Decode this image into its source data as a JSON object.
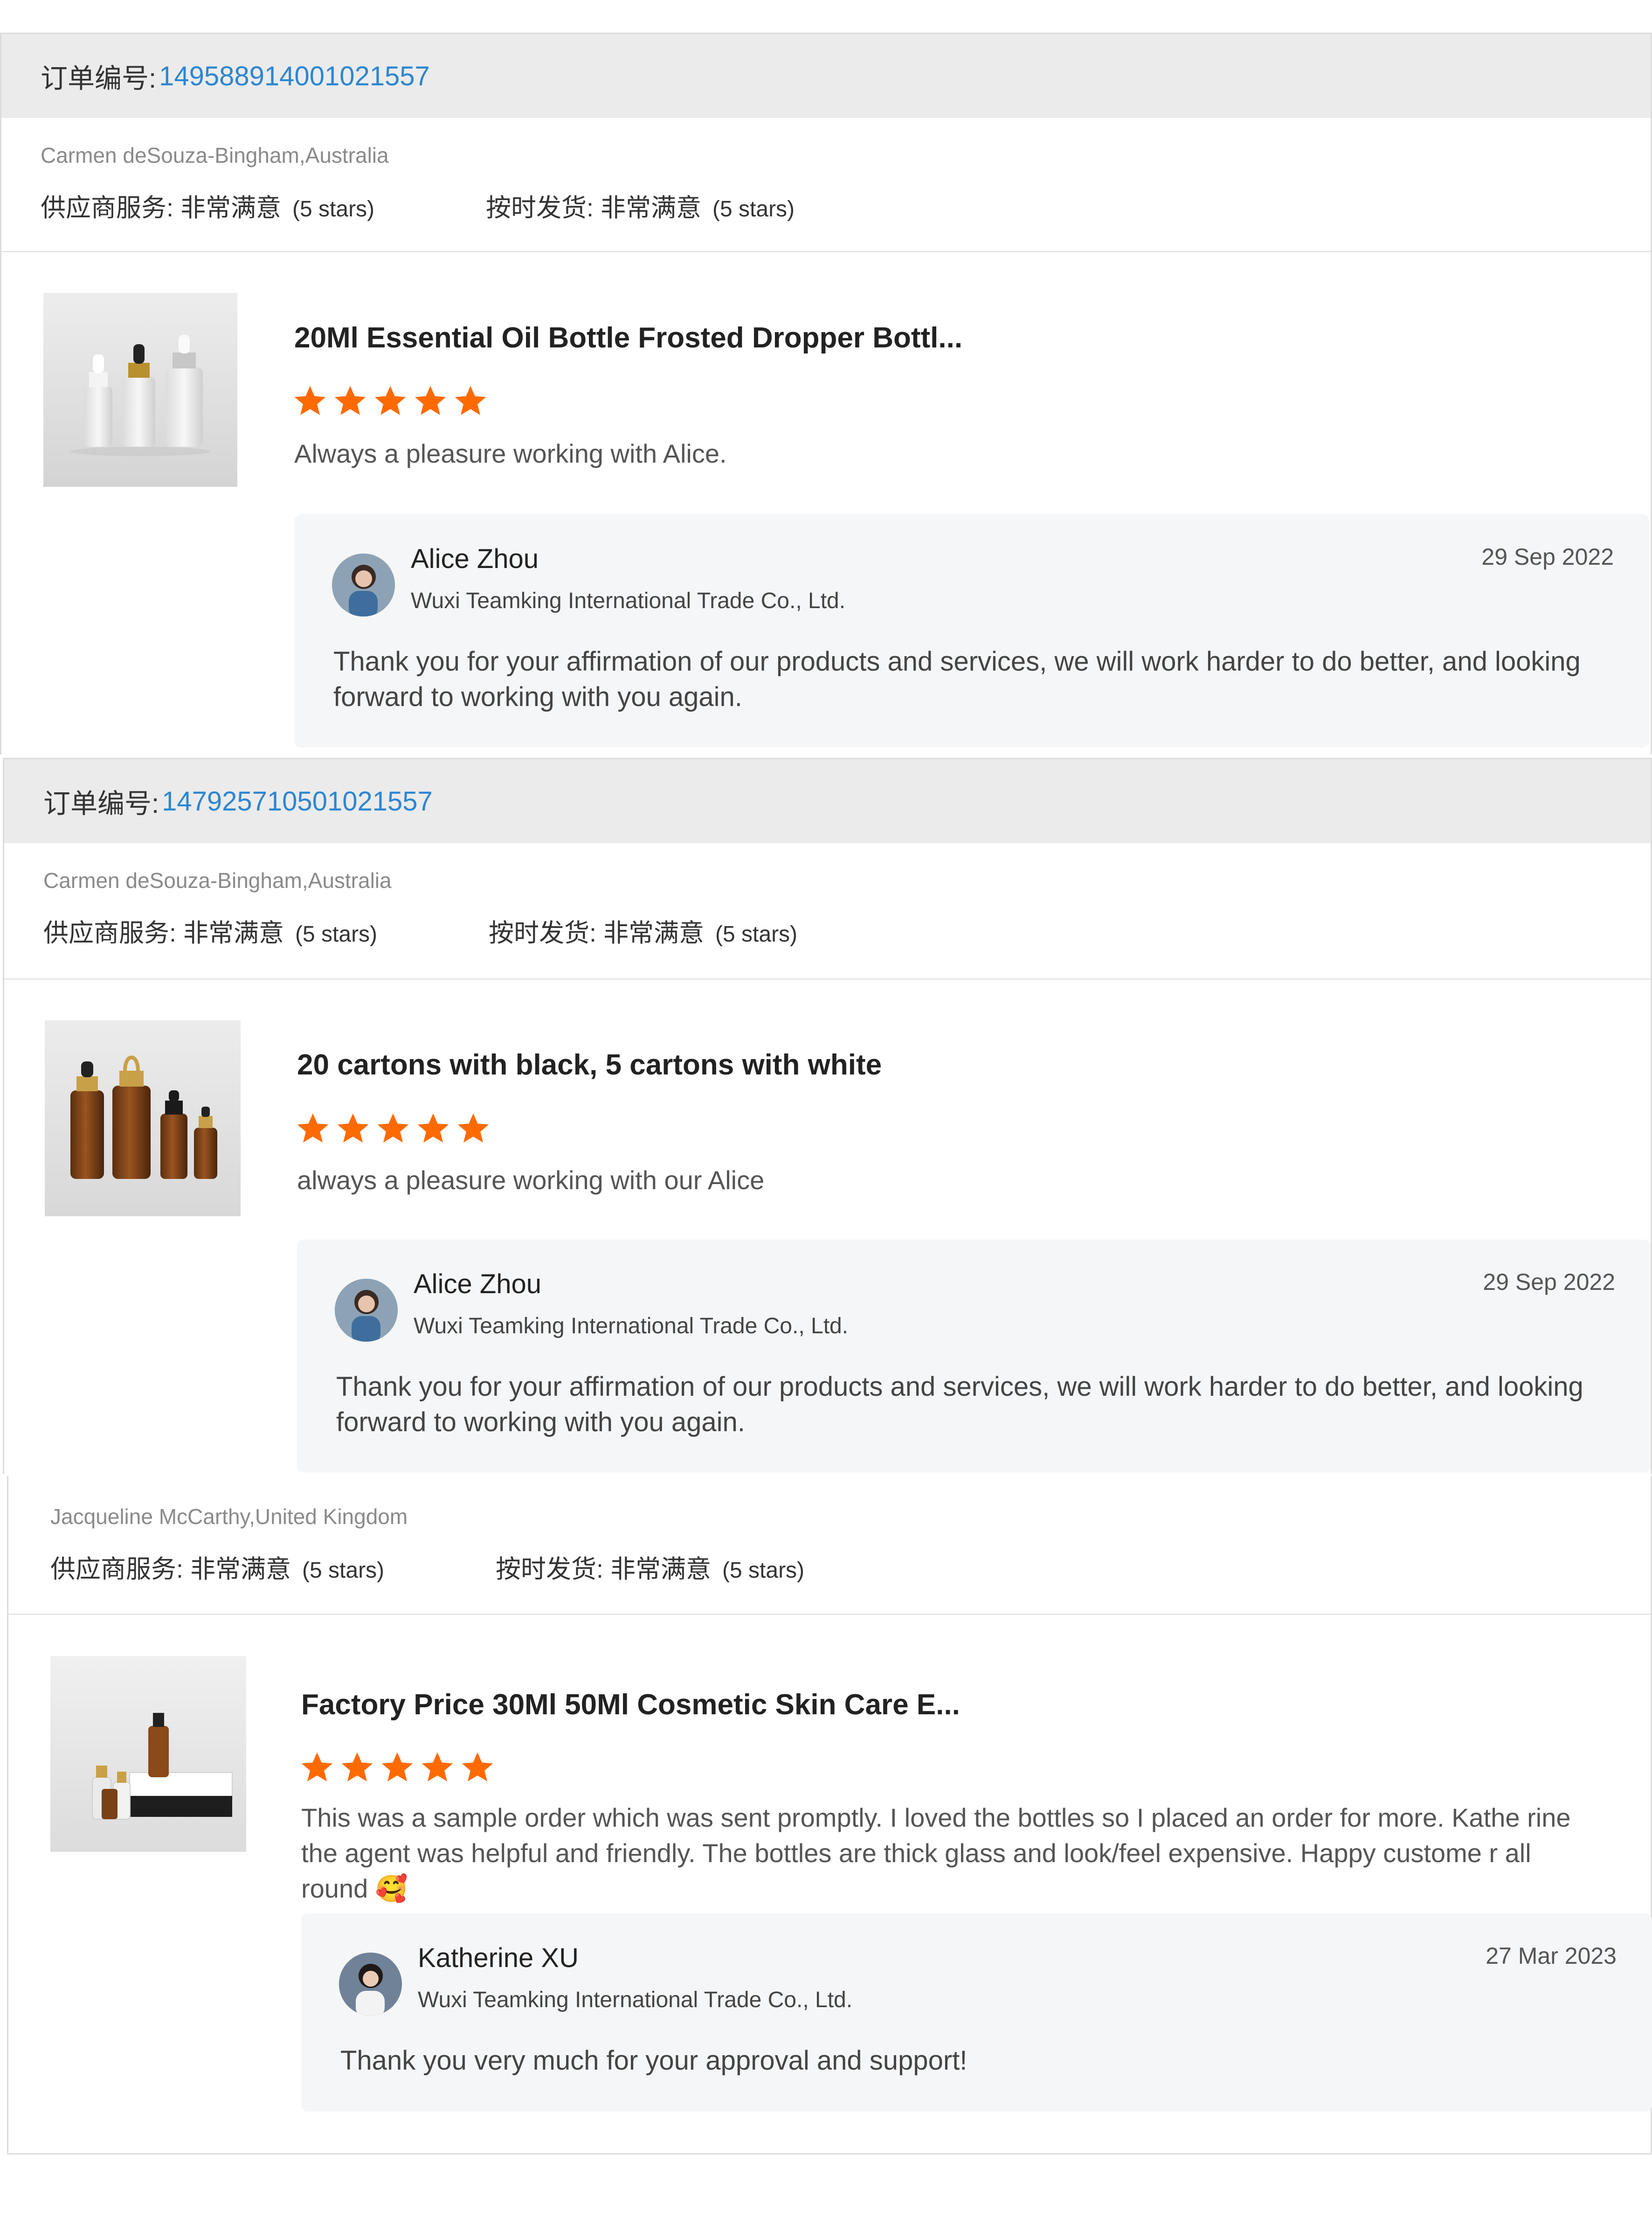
{
  "orders": [
    {
      "order_label": "订单编号:",
      "order_number": "149588914001021557",
      "buyer": "Carmen deSouza-Bingham,Australia",
      "supplier_service_label": "供应商服务: 非常满意",
      "supplier_service_stars": "(5 stars)",
      "on_time_label": "按时发货: 非常满意",
      "on_time_stars": "(5 stars)",
      "product_image": "frosted-dropper-bottles",
      "product_title": "20Ml Essential Oil Bottle Frosted Dropper Bottl...",
      "rating": 5,
      "comment": "Always a pleasure working with Alice.",
      "reply": {
        "name": "Alice Zhou",
        "company": "Wuxi Teamking International Trade Co., Ltd.",
        "date": "29 Sep 2022",
        "text": "Thank you for your affirmation of our products and services, we will work harder to do better, and looking forward to working with you again."
      }
    },
    {
      "order_label": "订单编号:",
      "order_number": "147925710501021557",
      "buyer": "Carmen deSouza-Bingham,Australia",
      "supplier_service_label": "供应商服务: 非常满意",
      "supplier_service_stars": "(5 stars)",
      "on_time_label": "按时发货: 非常满意",
      "on_time_stars": "(5 stars)",
      "product_image": "amber-dropper-bottles",
      "product_title": "20 cartons with black, 5 cartons with white",
      "rating": 5,
      "comment": "always a pleasure working with our Alice",
      "reply": {
        "name": "Alice Zhou",
        "company": "Wuxi Teamking International Trade Co., Ltd.",
        "date": "29 Sep 2022",
        "text": "Thank you for your affirmation of our products and services, we will work harder to do better, and looking forward to working with you again."
      }
    },
    {
      "buyer": "Jacqueline McCarthy,United Kingdom",
      "supplier_service_label": "供应商服务: 非常满意",
      "supplier_service_stars": "(5 stars)",
      "on_time_label": "按时发货: 非常满意",
      "on_time_stars": "(5 stars)",
      "product_image": "cosmetic-bottles-with-boxes",
      "product_title": "Factory Price 30Ml 50Ml Cosmetic Skin Care E...",
      "rating": 5,
      "comment": "This was a sample order which was sent promptly.  I loved the bottles so I  placed an order for more. Kathe rine the agent was helpful and friendly. The bottles are thick glass and look/feel expensive. Happy custome r all round 🥰",
      "reply": {
        "name": "Katherine XU",
        "company": "Wuxi Teamking International Trade Co., Ltd.",
        "date": "27 Mar 2023",
        "text": "Thank you very much for your approval and support!"
      }
    }
  ],
  "colors": {
    "order_number": "#2d86d1",
    "star": "#ff6a00",
    "header_bg": "#ebebeb",
    "reply_bg": "#f5f6f7"
  }
}
